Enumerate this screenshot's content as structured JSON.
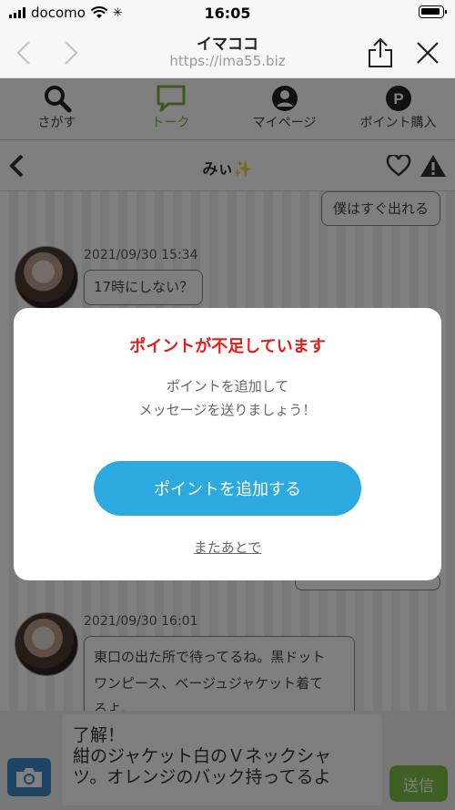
{
  "status_bar": {
    "carrier": "docomo",
    "time": "16:05"
  },
  "browser": {
    "title": "イマココ",
    "url": "https://ima55.biz"
  },
  "tabs": [
    {
      "label": "さがす",
      "icon": "search-icon"
    },
    {
      "label": "トーク",
      "icon": "chat-icon",
      "active": true
    },
    {
      "label": "マイページ",
      "icon": "user-icon"
    },
    {
      "label": "ポイント購入",
      "icon": "points-icon"
    }
  ],
  "chat": {
    "partner_name": "みぃ✨",
    "messages": [
      {
        "side": "right",
        "text": "僕はすぐ出れる"
      },
      {
        "side": "left",
        "time": "2021/09/30 15:34",
        "text": "17時にしない？"
      },
      {
        "side": "left",
        "time": "2021/09/30 16:01",
        "lines": [
          "東口の出た所で待ってるね。黒ドット",
          "ワンピース、ベージュジャケット着て",
          "るよ。"
        ]
      }
    ]
  },
  "composer": {
    "lines": [
      "了解！",
      "紺のジャケット白のＶネックシャ",
      "ツ。オレンジのバック持ってるよ"
    ],
    "send_label": "送信"
  },
  "modal": {
    "title": "ポイントが不足しています",
    "body_lines": [
      "ポイントを追加して",
      "メッセージを送りましょう！"
    ],
    "cta_label": "ポイントを追加する",
    "later_label": "またあとで"
  },
  "colors": {
    "accent_green": "#7aae3a",
    "cta_blue": "#2ca9df",
    "warning_red": "#e01e1e",
    "send_green": "#7cc04a"
  }
}
